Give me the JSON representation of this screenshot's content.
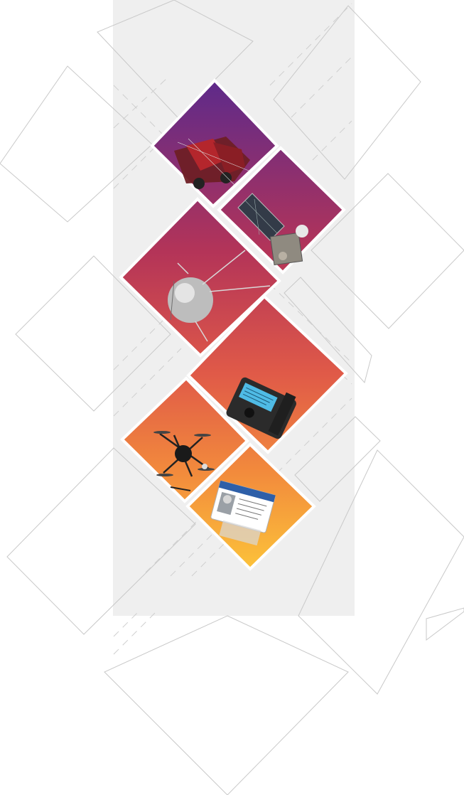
{
  "colors": {
    "panel": "#efefef",
    "gradient_top": "#5e2a8a",
    "gradient_mid": "#d94a4f",
    "gradient_bottom": "#fbbf3a",
    "line": "#c9c9c9"
  },
  "tiles": [
    {
      "id": "truck",
      "icon": "truck-icon"
    },
    {
      "id": "satellite",
      "icon": "satellite-icon"
    },
    {
      "id": "sputnik",
      "icon": "sputnik-icon"
    },
    {
      "id": "pager",
      "icon": "pager-icon"
    },
    {
      "id": "drone",
      "icon": "drone-icon"
    },
    {
      "id": "id-card",
      "icon": "id-card-icon"
    }
  ]
}
